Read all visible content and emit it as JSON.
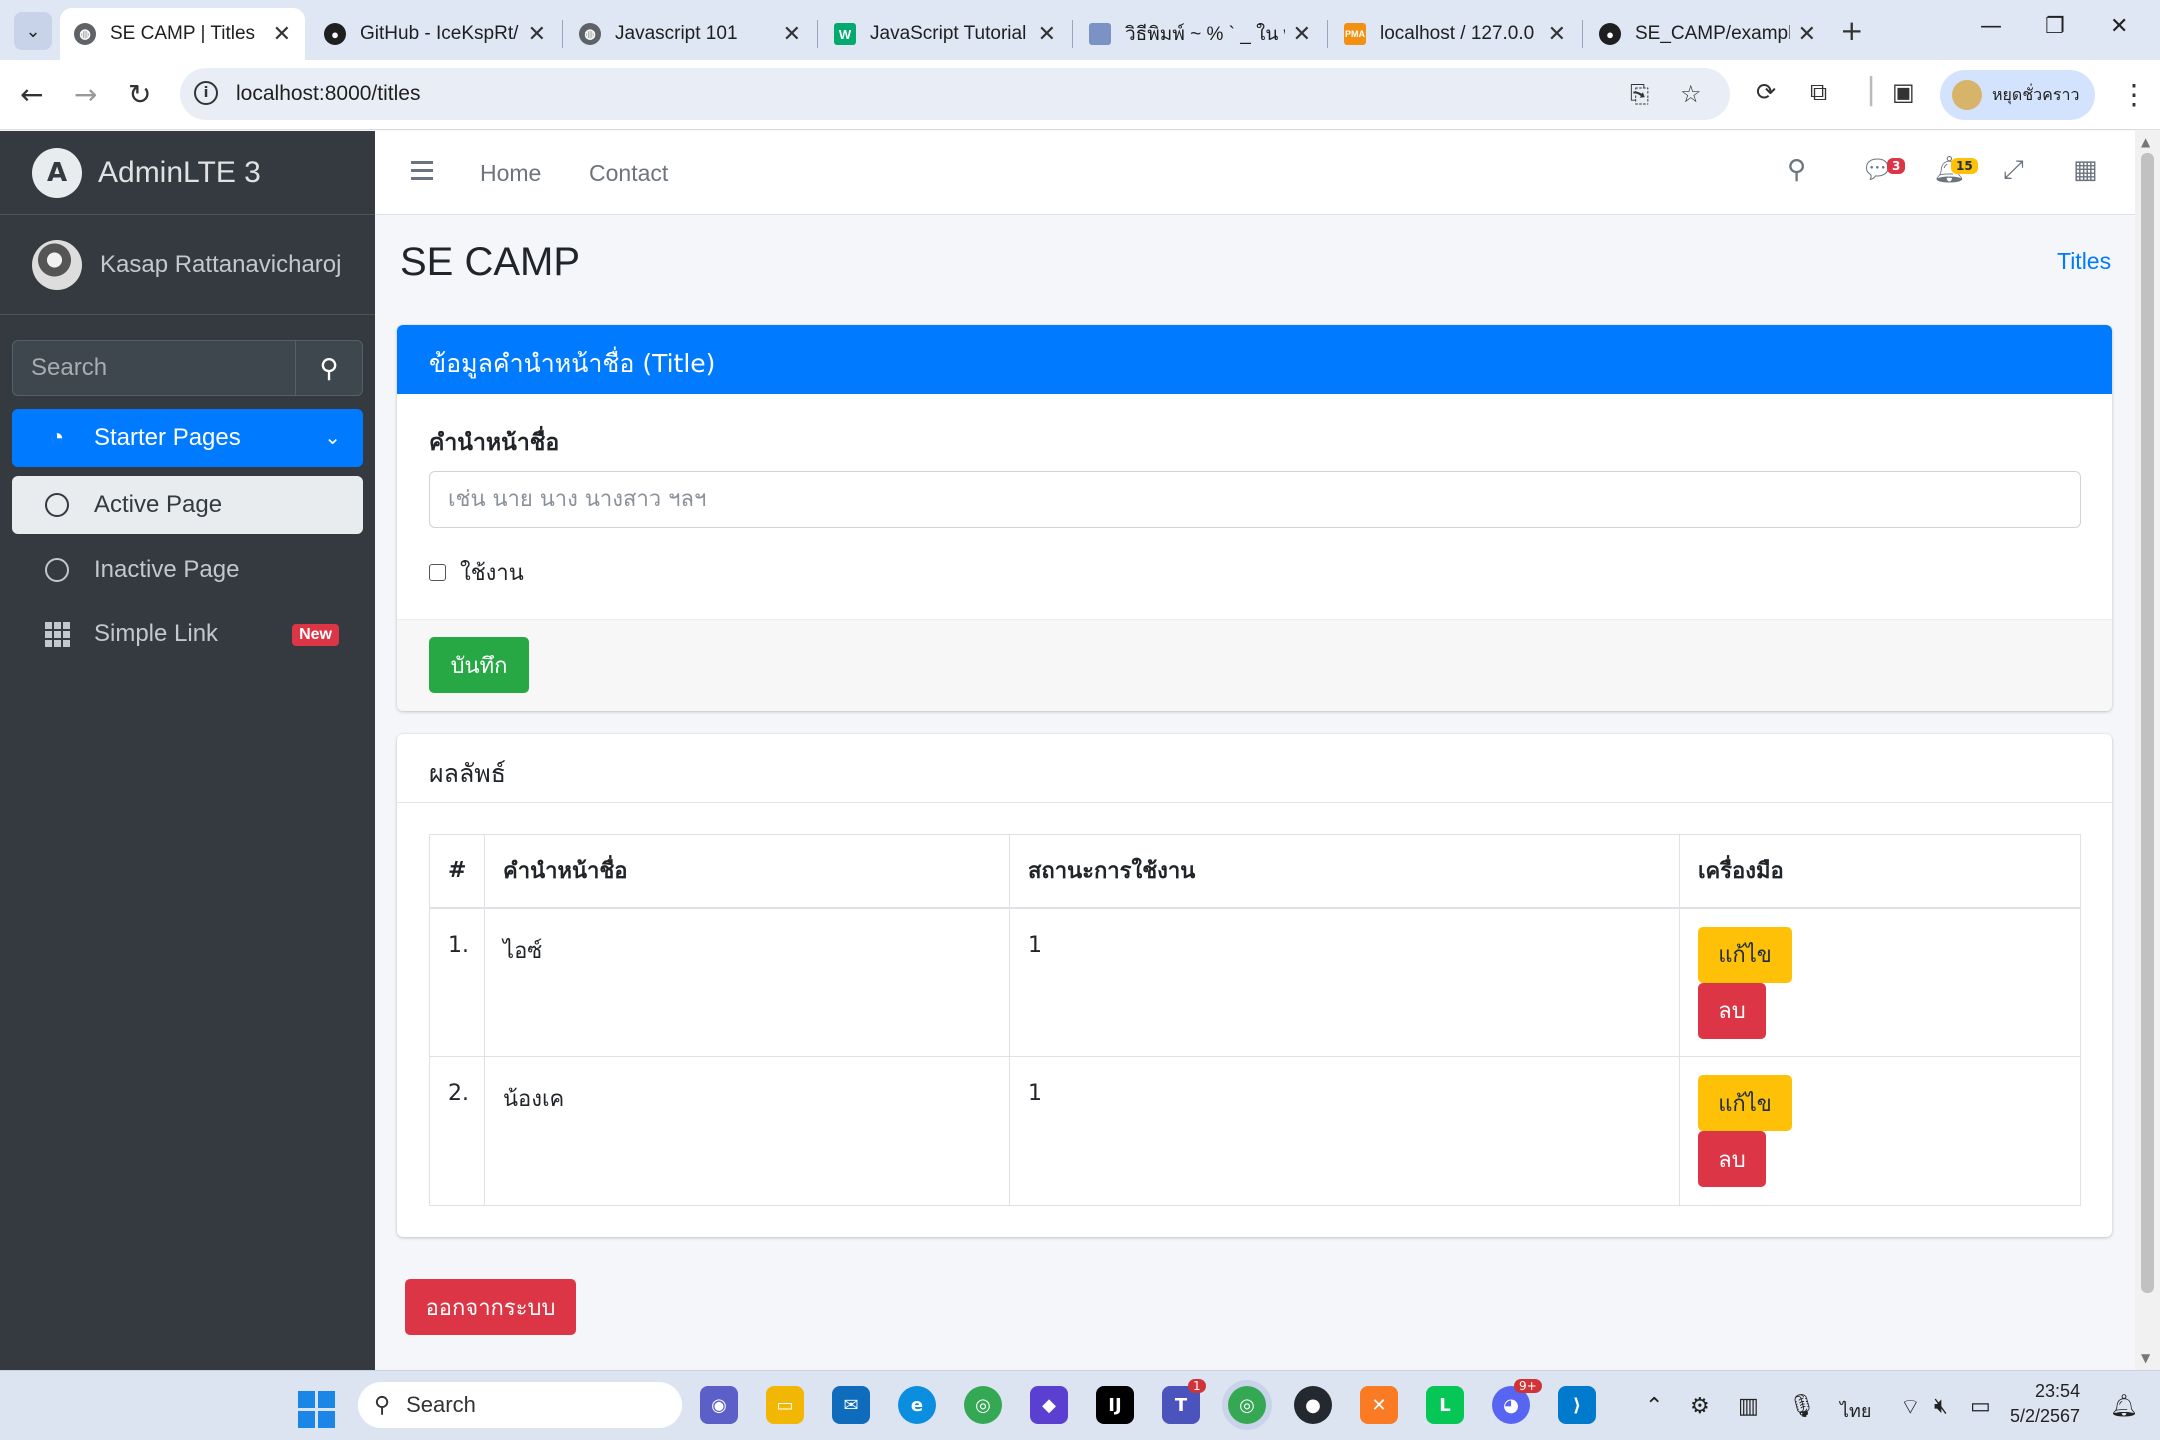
{
  "browser": {
    "tabs": [
      {
        "title": "SE CAMP | Titles",
        "active": true,
        "favicon": "globe-icon"
      },
      {
        "title": "GitHub - IceKspRt/",
        "active": false,
        "favicon": "github-icon"
      },
      {
        "title": "Javascript 101",
        "active": false,
        "favicon": "globe-icon"
      },
      {
        "title": "JavaScript Tutorial",
        "active": false,
        "favicon": "w3schools-icon"
      },
      {
        "title": "วิธีพิมพ์ ~ % ` _ ใน w",
        "active": false,
        "favicon": "avatar-icon"
      },
      {
        "title": "localhost / 127.0.0",
        "active": false,
        "favicon": "phpmyadmin-icon"
      },
      {
        "title": "SE_CAMP/example",
        "active": false,
        "favicon": "github-icon"
      }
    ],
    "url": "localhost:8000/titles",
    "profile_label": "หยุดชั่วคราว"
  },
  "sidebar": {
    "brand": "AdminLTE 3",
    "user": "Kasap Rattanavicharoj",
    "search_placeholder": "Search",
    "items": [
      {
        "label": "Starter Pages",
        "icon": "tachometer-icon"
      },
      {
        "label": "Active Page",
        "icon": "circle-icon"
      },
      {
        "label": "Inactive Page",
        "icon": "circle-icon"
      },
      {
        "label": "Simple Link",
        "icon": "th-icon",
        "badge": "New"
      }
    ]
  },
  "navbar": {
    "links": [
      "Home",
      "Contact"
    ],
    "messages_count": "3",
    "notifications_count": "15"
  },
  "page": {
    "title": "SE CAMP",
    "breadcrumb": "Titles"
  },
  "form_card": {
    "header": "ข้อมูลคำนำหน้าชื่อ (Title)",
    "label": "คำนำหน้าชื่อ",
    "placeholder": "เช่น นาย นาง นางสาว ฯลฯ",
    "checkbox_label": "ใช้งาน",
    "save_label": "บันทึก"
  },
  "result_card": {
    "title": "ผลลัพธ์",
    "columns": [
      "#",
      "คำนำหน้าชื่อ",
      "สถานะการใช้งาน",
      "เครื่องมือ"
    ],
    "rows": [
      {
        "no": "1.",
        "name": "ไอซ์",
        "status": "1",
        "edit": "แก้ไข",
        "delete": "ลบ"
      },
      {
        "no": "2.",
        "name": "น้องเค",
        "status": "1",
        "edit": "แก้ไข",
        "delete": "ลบ"
      }
    ]
  },
  "logout_label": "ออกจากระบบ",
  "taskbar": {
    "search_placeholder": "Search",
    "teams_badge": "1",
    "discord_badge": "9+",
    "language": "ไทย",
    "time": "23:54",
    "date": "5/2/2567"
  },
  "colors": {
    "primary": "#007bff",
    "success": "#28a745",
    "warning": "#ffc107",
    "danger": "#dc3545",
    "sidebar": "#343a40"
  }
}
